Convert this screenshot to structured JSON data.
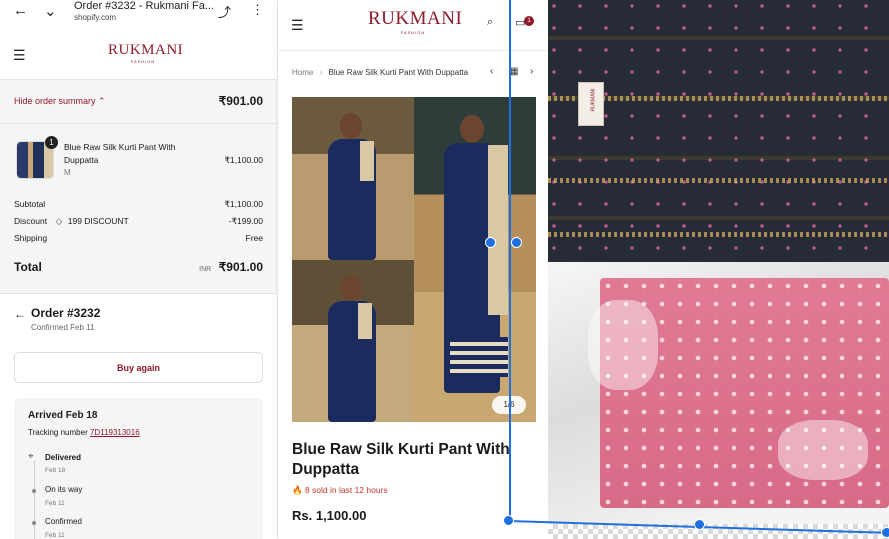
{
  "browser": {
    "tab_title": "Order #3232 - Rukmani Fa...",
    "url": "shopify.com",
    "icons": [
      "back-arrow-icon",
      "chevron-down-icon",
      "share-icon",
      "more-vert-icon"
    ]
  },
  "brand": {
    "logo_text": "RUKMANI",
    "logo_sub": "FASHION"
  },
  "order_summary": {
    "toggle_label": "Hide order summary",
    "total_display": "₹901.00",
    "item": {
      "quantity": "1",
      "name": "Blue Raw Silk Kurti Pant With Duppatta",
      "variant": "M",
      "price": "₹1,100.00"
    },
    "subtotal_label": "Subtotal",
    "subtotal_value": "₹1,100.00",
    "discount_label": "Discount",
    "discount_code": "199 DISCOUNT",
    "discount_value": "-₹199.00",
    "shipping_label": "Shipping",
    "shipping_value": "Free",
    "total_label": "Total",
    "total_currency": "INR",
    "total_value": "₹901.00"
  },
  "order": {
    "title": "Order #3232",
    "confirmed": "Confirmed Feb 11",
    "buy_again_label": "Buy again",
    "arrived": "Arrived Feb 18",
    "tracking_label": "Tracking number",
    "tracking_number": "7D119313016",
    "timeline": [
      {
        "label": "Delivered",
        "date": "Feb 18"
      },
      {
        "label": "On its way",
        "date": "Feb 11"
      },
      {
        "label": "Confirmed",
        "date": "Feb 11"
      }
    ]
  },
  "product_page": {
    "cart_count": "1",
    "breadcrumb_home": "Home",
    "breadcrumb_current": "Blue Raw Silk Kurti Pant With Duppatta",
    "gallery_counter": "1/6",
    "title": "Blue Raw Silk Kurti Pant With Duppatta",
    "sold_text": "8 sold in last 12 hours",
    "price": "Rs. 1,100.00"
  },
  "photo": {
    "tag_text": "RUKMANI"
  },
  "colors": {
    "brand": "#8e1b2b",
    "selection": "#1e6fe0"
  }
}
